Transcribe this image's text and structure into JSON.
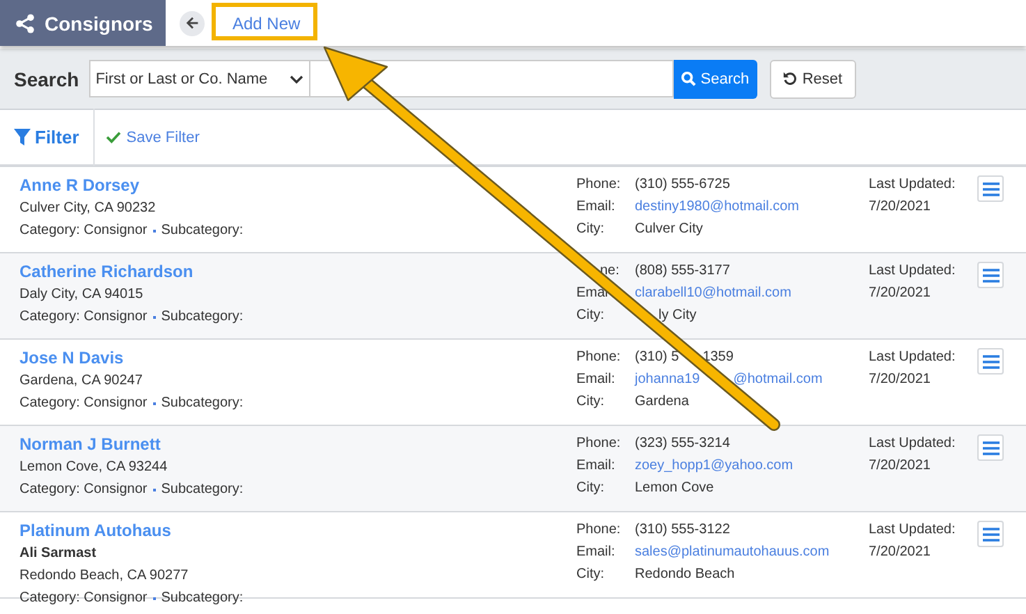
{
  "header": {
    "title": "Consignors",
    "add_new": "Add New"
  },
  "search": {
    "label": "Search",
    "select_value": "First or Last or Co. Name",
    "search_button": "Search",
    "reset_button": "Reset"
  },
  "filter": {
    "label": "Filter",
    "save_filter": "Save Filter"
  },
  "records": [
    {
      "name": "Anne R Dorsey",
      "address": "Culver City, CA 90232",
      "category": "Category: Consignor",
      "subcategory": "Subcategory:",
      "phone_label": [
        "Phone:"
      ],
      "phone": [
        "(310) 555-6725"
      ],
      "email_label": [
        "Email:"
      ],
      "email": [
        "destiny1980@hotmail.com"
      ],
      "city_label": "City:",
      "city": "Culver City",
      "updated_label": "Last Updated:",
      "updated": "7/20/2021"
    },
    {
      "name": "Catherine Richardson",
      "address": "Daly City, CA 94015",
      "category": "Category: Consignor",
      "subcategory": "Subcategory:",
      "phone_label": [
        "ne:"
      ],
      "phone_label_start_hidden": true,
      "phone": [
        "(808) 555-3177"
      ],
      "email_label": [
        "Emai"
      ],
      "email": [
        "clarabell10@hotmail.com"
      ],
      "city_label": "City:",
      "city": "ly City",
      "city_start_hidden": true,
      "updated_label": "Last Updated:",
      "updated": "7/20/2021"
    },
    {
      "name": "Jose N Davis",
      "address": "Gardena, CA 90247",
      "category": "Category: Consignor",
      "subcategory": "Subcategory:",
      "phone_label": [
        "Phone:"
      ],
      "phone": [
        "(310) 5",
        "1359"
      ],
      "email_label": [
        "Email:"
      ],
      "email": [
        "johanna19",
        "@hotmail.com"
      ],
      "city_label": "City:",
      "city": "Gardena",
      "updated_label": "Last Updated:",
      "updated": "7/20/2021"
    },
    {
      "name": "Norman J Burnett",
      "address": "Lemon Cove, CA 93244",
      "category": "Category: Consignor",
      "subcategory": "Subcategory:",
      "phone_label": [
        "Phone:"
      ],
      "phone": [
        "(323) 555-3214"
      ],
      "email_label": [
        "Email:"
      ],
      "email": [
        "zoey_hopp1@yahoo.com"
      ],
      "city_label": "City:",
      "city": "Lemon Cove",
      "updated_label": "Last Updated:",
      "updated": "7/20/2021"
    },
    {
      "name": "Platinum Autohaus",
      "contact": "Ali Sarmast",
      "address": "Redondo Beach, CA 90277",
      "category": "Category: Consignor",
      "subcategory": "Subcategory:",
      "phone_label": [
        "Phone:"
      ],
      "phone": [
        "(310) 555-3122"
      ],
      "email_label": [
        "Email:"
      ],
      "email": [
        "sales@platinumautohauus.com"
      ],
      "city_label": "City:",
      "city": "Redondo Beach",
      "updated_label": "Last Updated:",
      "updated": "7/20/2021"
    }
  ]
}
